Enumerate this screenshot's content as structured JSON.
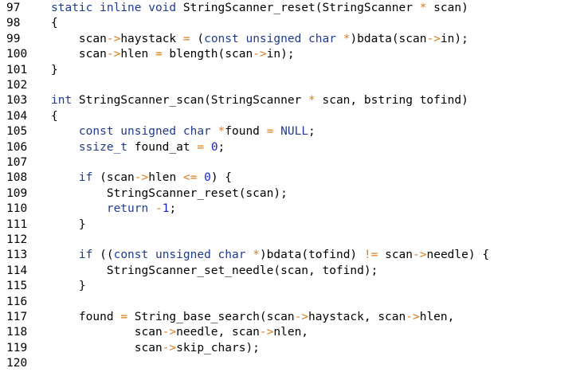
{
  "colors": {
    "background": "#ffffff",
    "text": "#000000",
    "keyword": "#1f3b8f",
    "operator": "#e07b1a",
    "number": "#1a23c9"
  },
  "lines": [
    {
      "num": "97",
      "tokens": [
        {
          "t": "kw",
          "s": "static inline void"
        },
        {
          "t": "txt",
          "s": " StringScanner_reset(StringScanner "
        },
        {
          "t": "op",
          "s": "*"
        },
        {
          "t": "txt",
          "s": " scan)"
        }
      ]
    },
    {
      "num": "98",
      "tokens": [
        {
          "t": "txt",
          "s": "{"
        }
      ]
    },
    {
      "num": "99",
      "tokens": [
        {
          "t": "txt",
          "s": "    scan"
        },
        {
          "t": "op",
          "s": "->"
        },
        {
          "t": "txt",
          "s": "haystack "
        },
        {
          "t": "op",
          "s": "="
        },
        {
          "t": "txt",
          "s": " ("
        },
        {
          "t": "kw",
          "s": "const unsigned char"
        },
        {
          "t": "txt",
          "s": " "
        },
        {
          "t": "op",
          "s": "*"
        },
        {
          "t": "txt",
          "s": ")bdata(scan"
        },
        {
          "t": "op",
          "s": "->"
        },
        {
          "t": "txt",
          "s": "in);"
        }
      ]
    },
    {
      "num": "100",
      "tokens": [
        {
          "t": "txt",
          "s": "    scan"
        },
        {
          "t": "op",
          "s": "->"
        },
        {
          "t": "txt",
          "s": "hlen "
        },
        {
          "t": "op",
          "s": "="
        },
        {
          "t": "txt",
          "s": " blength(scan"
        },
        {
          "t": "op",
          "s": "->"
        },
        {
          "t": "txt",
          "s": "in);"
        }
      ]
    },
    {
      "num": "101",
      "tokens": [
        {
          "t": "txt",
          "s": "}"
        }
      ]
    },
    {
      "num": "102",
      "tokens": []
    },
    {
      "num": "103",
      "tokens": [
        {
          "t": "kw",
          "s": "int"
        },
        {
          "t": "txt",
          "s": " StringScanner_scan(StringScanner "
        },
        {
          "t": "op",
          "s": "*"
        },
        {
          "t": "txt",
          "s": " scan, bstring tofind)"
        }
      ]
    },
    {
      "num": "104",
      "tokens": [
        {
          "t": "txt",
          "s": "{"
        }
      ]
    },
    {
      "num": "105",
      "tokens": [
        {
          "t": "txt",
          "s": "    "
        },
        {
          "t": "kw",
          "s": "const unsigned char"
        },
        {
          "t": "txt",
          "s": " "
        },
        {
          "t": "op",
          "s": "*"
        },
        {
          "t": "txt",
          "s": "found "
        },
        {
          "t": "op",
          "s": "="
        },
        {
          "t": "txt",
          "s": " "
        },
        {
          "t": "kw",
          "s": "NULL"
        },
        {
          "t": "txt",
          "s": ";"
        }
      ]
    },
    {
      "num": "106",
      "tokens": [
        {
          "t": "txt",
          "s": "    "
        },
        {
          "t": "kw",
          "s": "ssize_t"
        },
        {
          "t": "txt",
          "s": " found_at "
        },
        {
          "t": "op",
          "s": "="
        },
        {
          "t": "txt",
          "s": " "
        },
        {
          "t": "num",
          "s": "0"
        },
        {
          "t": "txt",
          "s": ";"
        }
      ]
    },
    {
      "num": "107",
      "tokens": []
    },
    {
      "num": "108",
      "tokens": [
        {
          "t": "txt",
          "s": "    "
        },
        {
          "t": "kw",
          "s": "if"
        },
        {
          "t": "txt",
          "s": " (scan"
        },
        {
          "t": "op",
          "s": "->"
        },
        {
          "t": "txt",
          "s": "hlen "
        },
        {
          "t": "op",
          "s": "<="
        },
        {
          "t": "txt",
          "s": " "
        },
        {
          "t": "num",
          "s": "0"
        },
        {
          "t": "txt",
          "s": ") {"
        }
      ]
    },
    {
      "num": "109",
      "tokens": [
        {
          "t": "txt",
          "s": "        StringScanner_reset(scan);"
        }
      ]
    },
    {
      "num": "110",
      "tokens": [
        {
          "t": "txt",
          "s": "        "
        },
        {
          "t": "kw",
          "s": "return"
        },
        {
          "t": "txt",
          "s": " "
        },
        {
          "t": "op",
          "s": "-"
        },
        {
          "t": "num",
          "s": "1"
        },
        {
          "t": "txt",
          "s": ";"
        }
      ]
    },
    {
      "num": "111",
      "tokens": [
        {
          "t": "txt",
          "s": "    }"
        }
      ]
    },
    {
      "num": "112",
      "tokens": []
    },
    {
      "num": "113",
      "tokens": [
        {
          "t": "txt",
          "s": "    "
        },
        {
          "t": "kw",
          "s": "if"
        },
        {
          "t": "txt",
          "s": " (("
        },
        {
          "t": "kw",
          "s": "const unsigned char"
        },
        {
          "t": "txt",
          "s": " "
        },
        {
          "t": "op",
          "s": "*"
        },
        {
          "t": "txt",
          "s": ")bdata(tofind) "
        },
        {
          "t": "op",
          "s": "!="
        },
        {
          "t": "txt",
          "s": " scan"
        },
        {
          "t": "op",
          "s": "->"
        },
        {
          "t": "txt",
          "s": "needle) {"
        }
      ]
    },
    {
      "num": "114",
      "tokens": [
        {
          "t": "txt",
          "s": "        StringScanner_set_needle(scan, tofind);"
        }
      ]
    },
    {
      "num": "115",
      "tokens": [
        {
          "t": "txt",
          "s": "    }"
        }
      ]
    },
    {
      "num": "116",
      "tokens": []
    },
    {
      "num": "117",
      "tokens": [
        {
          "t": "txt",
          "s": "    found "
        },
        {
          "t": "op",
          "s": "="
        },
        {
          "t": "txt",
          "s": " String_base_search(scan"
        },
        {
          "t": "op",
          "s": "->"
        },
        {
          "t": "txt",
          "s": "haystack, scan"
        },
        {
          "t": "op",
          "s": "->"
        },
        {
          "t": "txt",
          "s": "hlen,"
        }
      ]
    },
    {
      "num": "118",
      "tokens": [
        {
          "t": "txt",
          "s": "            scan"
        },
        {
          "t": "op",
          "s": "->"
        },
        {
          "t": "txt",
          "s": "needle, scan"
        },
        {
          "t": "op",
          "s": "->"
        },
        {
          "t": "txt",
          "s": "nlen,"
        }
      ]
    },
    {
      "num": "119",
      "tokens": [
        {
          "t": "txt",
          "s": "            scan"
        },
        {
          "t": "op",
          "s": "->"
        },
        {
          "t": "txt",
          "s": "skip_chars);"
        }
      ]
    },
    {
      "num": "120",
      "tokens": []
    }
  ]
}
